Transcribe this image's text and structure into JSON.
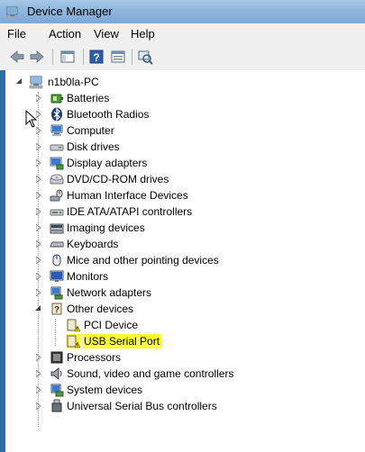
{
  "window": {
    "title": "Device Manager",
    "icon": "device-manager-icon"
  },
  "menu": [
    "File",
    "Action",
    "View",
    "Help"
  ],
  "toolbar": {
    "buttons": [
      "back-arrow-icon",
      "forward-arrow-icon",
      "show-hide-console-tree-icon",
      "help-icon",
      "properties-icon",
      "scan-hardware-icon"
    ]
  },
  "tree": {
    "root": "n1b0la-PC",
    "categories": [
      {
        "label": "Batteries",
        "icon": "battery-icon"
      },
      {
        "label": "Bluetooth Radios",
        "icon": "bluetooth-icon"
      },
      {
        "label": "Computer",
        "icon": "computer-icon"
      },
      {
        "label": "Disk drives",
        "icon": "disk-drive-icon"
      },
      {
        "label": "Display adapters",
        "icon": "display-adapter-icon"
      },
      {
        "label": "DVD/CD-ROM drives",
        "icon": "dvd-drive-icon"
      },
      {
        "label": "Human Interface Devices",
        "icon": "hid-icon"
      },
      {
        "label": "IDE ATA/ATAPI controllers",
        "icon": "ide-controller-icon"
      },
      {
        "label": "Imaging devices",
        "icon": "camera-icon"
      },
      {
        "label": "Keyboards",
        "icon": "keyboard-icon"
      },
      {
        "label": "Mice and other pointing devices",
        "icon": "mouse-icon"
      },
      {
        "label": "Monitors",
        "icon": "monitor-icon"
      },
      {
        "label": "Network adapters",
        "icon": "network-adapter-icon"
      },
      {
        "label": "Other devices",
        "icon": "unknown-device-icon",
        "expanded": true,
        "children": [
          {
            "label": "PCI Device",
            "icon": "warning-device-icon"
          },
          {
            "label": "USB Serial Port",
            "icon": "warning-device-icon",
            "highlighted": true
          }
        ]
      },
      {
        "label": "Processors",
        "icon": "processor-icon"
      },
      {
        "label": "Sound, video and game controllers",
        "icon": "speaker-icon"
      },
      {
        "label": "System devices",
        "icon": "system-device-icon"
      },
      {
        "label": "Universal Serial Bus controllers",
        "icon": "usb-icon"
      }
    ]
  },
  "colors": {
    "highlight": "#ffff33",
    "titlebar": "#8fb6dd"
  }
}
